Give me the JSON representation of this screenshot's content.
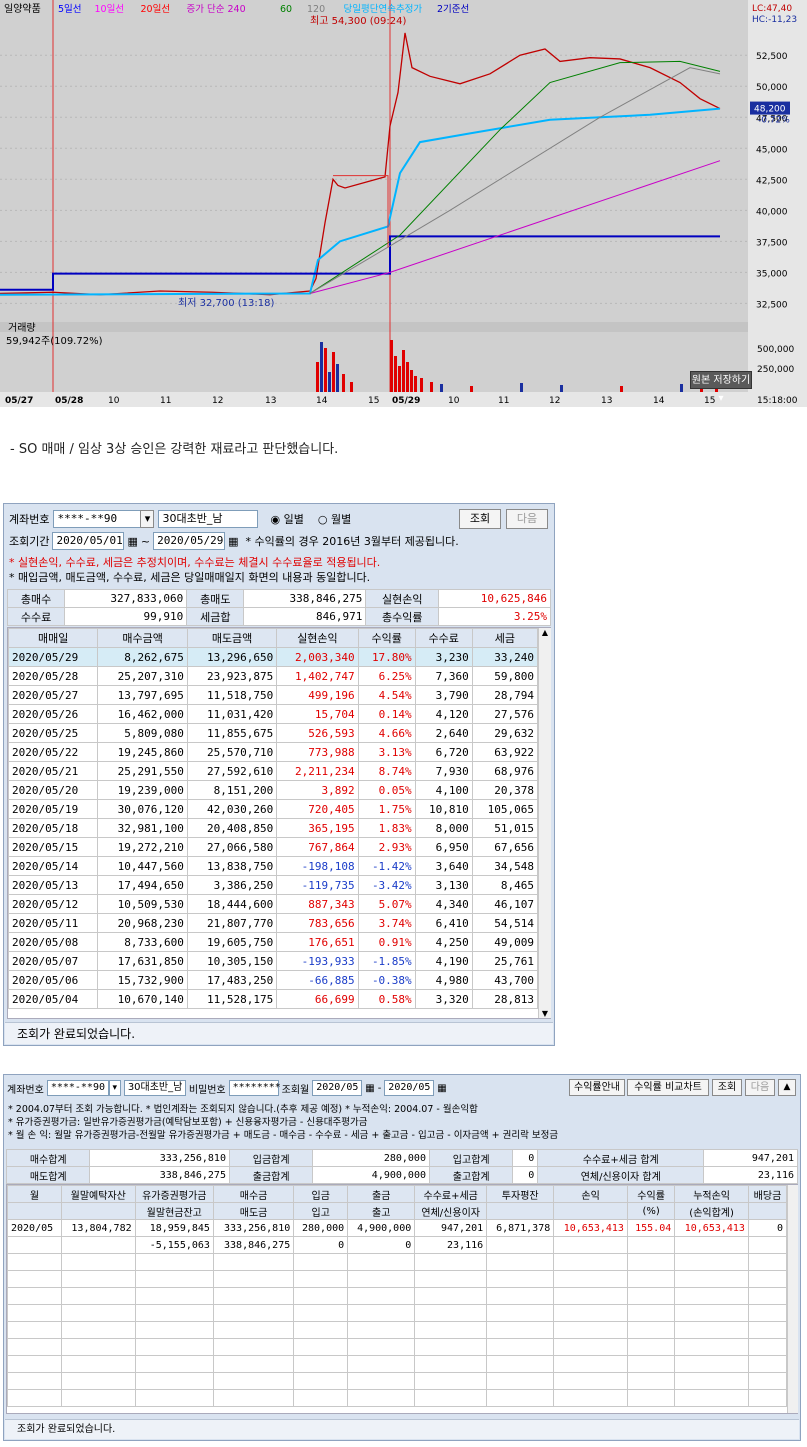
{
  "chart": {
    "stock_name": "일양약품",
    "ma_legend": [
      "5일선",
      "10일선",
      "20일선",
      "증가 단순 240",
      "60",
      "120",
      "당일평단연속추정가",
      "2기준선"
    ],
    "lc": "LC:47,40",
    "hc": "HC:-11,23",
    "high_label": "최고 54,300 (09:24)",
    "low_label": "최저 32,700 (13:18)",
    "price_ticks": [
      "52,500",
      "50,000",
      "47,500",
      "45,000",
      "42,500",
      "40,000",
      "37,500",
      "35,000",
      "32,500"
    ],
    "current_price": "48,200",
    "current_change": "-0.72%",
    "volume_title": "거래량",
    "volume_value": "59,942주(109.72%)",
    "volume_ticks": [
      "500,000",
      "250,000"
    ],
    "time_ticks": [
      "05/27",
      "05/28",
      "10",
      "11",
      "12",
      "13",
      "14",
      "15",
      "05/29",
      "10",
      "11",
      "12",
      "13",
      "14",
      "15",
      "15:18:00"
    ],
    "save_button": "원본 저장하기",
    "price_range": [
      31000,
      55500
    ],
    "colors": {
      "ma5": "#0000ff",
      "ma10": "#ff00ff",
      "ma20": "#ff0000",
      "ma240": "#c800c8",
      "ma60": "#008000",
      "ma120": "#808080",
      "avg": "#00b4ff",
      "base": "#0000c0"
    }
  },
  "caption": "- SO 매매 / 임상 3상 승인은 강력한 재료라고 판단했습니다.",
  "w1": {
    "account_label": "계좌번호",
    "account": "****-**90",
    "owner": "30대초반_남",
    "radio_daily": "일별",
    "radio_monthly": "월별",
    "btn_query": "조회",
    "btn_next": "다음",
    "period_label": "조회기간",
    "date_from": "2020/05/01",
    "date_to": "2020/05/29",
    "tilde": "~",
    "period_note": "* 수익률의 경우 2016년 3월부터 제공됩니다.",
    "note_red": "* 실현손익, 수수료, 세금은 추정치이며, 수수료는 체결시 수수료율로 적용됩니다.",
    "note_black": "* 매입금액, 매도금액, 수수료, 세금은 당일매매일지 화면의 내용과 동일합니다.",
    "summary": [
      {
        "k1": "총매수",
        "v1": "327,833,060",
        "k2": "총매도",
        "v2": "338,846,275",
        "k3": "실현손익",
        "v3": "10,625,846"
      },
      {
        "k1": "수수료",
        "v1": "99,910",
        "k2": "세금합",
        "v2": "846,971",
        "k3": "총수익률",
        "v3": "3.25%"
      }
    ],
    "headers": [
      "매매일",
      "매수금액",
      "매도금액",
      "실현손익",
      "수익률",
      "수수료",
      "세금"
    ],
    "rows": [
      [
        "2020/05/29",
        "8,262,675",
        "13,296,650",
        "2,003,340",
        "17.80%",
        "3,230",
        "33,240"
      ],
      [
        "2020/05/28",
        "25,207,310",
        "23,923,875",
        "1,402,747",
        "6.25%",
        "7,360",
        "59,800"
      ],
      [
        "2020/05/27",
        "13,797,695",
        "11,518,750",
        "499,196",
        "4.54%",
        "3,790",
        "28,794"
      ],
      [
        "2020/05/26",
        "16,462,000",
        "11,031,420",
        "15,704",
        "0.14%",
        "4,120",
        "27,576"
      ],
      [
        "2020/05/25",
        "5,809,080",
        "11,855,675",
        "526,593",
        "4.66%",
        "2,640",
        "29,632"
      ],
      [
        "2020/05/22",
        "19,245,860",
        "25,570,710",
        "773,988",
        "3.13%",
        "6,720",
        "63,922"
      ],
      [
        "2020/05/21",
        "25,291,550",
        "27,592,610",
        "2,211,234",
        "8.74%",
        "7,930",
        "68,976"
      ],
      [
        "2020/05/20",
        "19,239,000",
        "8,151,200",
        "3,892",
        "0.05%",
        "4,100",
        "20,378"
      ],
      [
        "2020/05/19",
        "30,076,120",
        "42,030,260",
        "720,405",
        "1.75%",
        "10,810",
        "105,065"
      ],
      [
        "2020/05/18",
        "32,981,100",
        "20,408,850",
        "365,195",
        "1.83%",
        "8,000",
        "51,015"
      ],
      [
        "2020/05/15",
        "19,272,210",
        "27,066,580",
        "767,864",
        "2.93%",
        "6,950",
        "67,656"
      ],
      [
        "2020/05/14",
        "10,447,560",
        "13,838,750",
        "-198,108",
        "-1.42%",
        "3,640",
        "34,548"
      ],
      [
        "2020/05/13",
        "17,494,650",
        "3,386,250",
        "-119,735",
        "-3.42%",
        "3,130",
        "8,465"
      ],
      [
        "2020/05/12",
        "10,509,530",
        "18,444,600",
        "887,343",
        "5.07%",
        "4,340",
        "46,107"
      ],
      [
        "2020/05/11",
        "20,968,230",
        "21,807,770",
        "783,656",
        "3.74%",
        "6,410",
        "54,514"
      ],
      [
        "2020/05/08",
        "8,733,600",
        "19,605,750",
        "176,651",
        "0.91%",
        "4,250",
        "49,009"
      ],
      [
        "2020/05/07",
        "17,631,850",
        "10,305,150",
        "-193,933",
        "-1.85%",
        "4,190",
        "25,761"
      ],
      [
        "2020/05/06",
        "15,732,900",
        "17,483,250",
        "-66,885",
        "-0.38%",
        "4,980",
        "43,700"
      ],
      [
        "2020/05/04",
        "10,670,140",
        "11,528,175",
        "66,699",
        "0.58%",
        "3,320",
        "28,813"
      ]
    ],
    "status": "조회가 완료되었습니다."
  },
  "w2": {
    "account_label": "계좌번호",
    "account": "****-**90",
    "owner": "30대초반_남",
    "pw_label": "비밀번호",
    "pw": "********",
    "month_label": "조회월",
    "month_from": "2020/05",
    "dash": "-",
    "month_to": "2020/05",
    "btn_guide": "수익률안내",
    "btn_compare": "수익률 비교차트",
    "btn_query": "조회",
    "btn_next": "다음",
    "notes": [
      "* 2004.07부터 조회 가능합니다.   * 법인계좌는 조회되지 않습니다.(추후 제공 예정)   * 누적손익: 2004.07 - 월손익합",
      "* 유가증권평가금: 일반유가증권평가금(예탁담보포함) + 신용융자평가금 - 신용대주평가금",
      "* 월 손 익: 월말 유가증권평가금-전월말 유가증권평가금 + 매도금 - 매수금 - 수수료 - 세금 + 출고금 - 입고금 - 이자금액 + 권리락 보정금"
    ],
    "summary": [
      [
        "매수합계",
        "333,256,810",
        "입금합계",
        "280,000",
        "입고합계",
        "0",
        "수수료+세금 합계",
        "947,201"
      ],
      [
        "매도합계",
        "338,846,275",
        "출금합계",
        "4,900,000",
        "출고합계",
        "0",
        "연체/신용이자 합계",
        "23,116"
      ]
    ],
    "headers_top": [
      "월",
      "월말예탁자산",
      "유가증권평가금",
      "매수금",
      "입금",
      "출금",
      "수수료+세금",
      "투자평잔",
      "손익",
      "수익률",
      "누적손익",
      "배당금"
    ],
    "headers_bot": [
      "",
      "",
      "월말현금잔고",
      "매도금",
      "입고",
      "출고",
      "연체/신용이자",
      "",
      "",
      "(%)",
      "(손익합계)",
      ""
    ],
    "row_top": [
      "2020/05",
      "13,804,782",
      "18,959,845",
      "333,256,810",
      "280,000",
      "4,900,000",
      "947,201",
      "6,871,378",
      "10,653,413",
      "155.04",
      "10,653,413",
      "0"
    ],
    "row_bot": [
      "",
      "",
      "-5,155,063",
      "338,846,275",
      "0",
      "0",
      "23,116",
      "",
      "",
      "",
      "",
      ""
    ],
    "status": "조회가 완료되었습니다."
  }
}
